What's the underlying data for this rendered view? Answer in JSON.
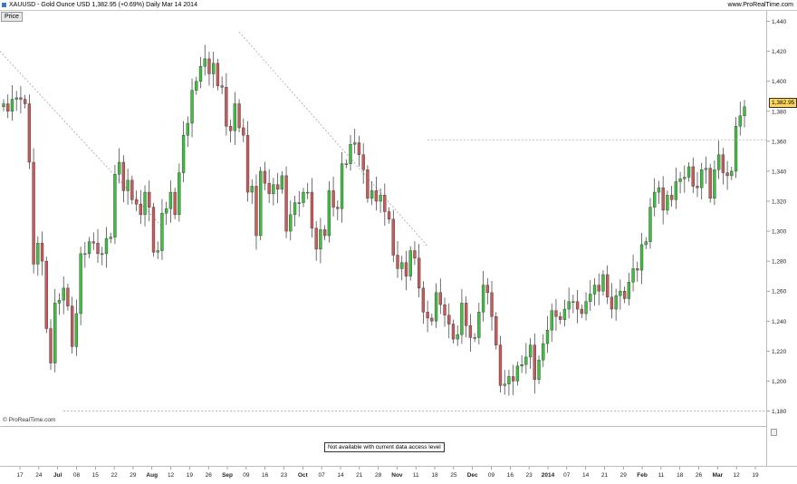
{
  "header": {
    "title": "XAUUSD - Gold Ounce USD     1,382.95 (+0.69%)     Daily  Mar 14 2014",
    "brand": "www.ProRealTime.com"
  },
  "panel_tab": "Price",
  "copyright": "© ProRealTime.com",
  "indicator_notice": "Not available with current data access level",
  "colors": {
    "up": "#3fbf3f",
    "down": "#c85a5a",
    "wick": "#333333",
    "trend": "#999999",
    "last_price_bg": "#ffd65c"
  },
  "chart_data": {
    "type": "candlestick",
    "title": "XAUUSD - Gold Ounce USD",
    "last_price_label": "1,382.95",
    "ylim": [
      1170,
      1447
    ],
    "y_ticks": [
      "1,180",
      "1,200",
      "1,220",
      "1,240",
      "1,260",
      "1,280",
      "1,300",
      "1,320",
      "1,340",
      "1,360",
      "1,380",
      "1,400",
      "1,420",
      "1,440"
    ],
    "x_ticks": [
      "17",
      "24",
      "Jul",
      "08",
      "15",
      "22",
      "29",
      "Aug",
      "12",
      "19",
      "26",
      "Sep",
      "09",
      "16",
      "23",
      "Oct",
      "07",
      "14",
      "21",
      "28",
      "Nov",
      "11",
      "18",
      "25",
      "Dec",
      "09",
      "16",
      "23",
      "2014",
      "07",
      "14",
      "21",
      "29",
      "Feb",
      "11",
      "18",
      "26",
      "Mar",
      "12",
      "19"
    ],
    "bold_x_ticks": [
      "Jul",
      "Aug",
      "Sep",
      "Oct",
      "Nov",
      "Dec",
      "2014",
      "Feb",
      "Mar"
    ],
    "closes": [
      1385,
      1380,
      1388,
      1389,
      1388,
      1385,
      1346,
      1278,
      1292,
      1280,
      1235,
      1212,
      1252,
      1254,
      1262,
      1250,
      1223,
      1245,
      1285,
      1285,
      1293,
      1292,
      1285,
      1285,
      1295,
      1296,
      1338,
      1346,
      1327,
      1334,
      1321,
      1318,
      1311,
      1326,
      1316,
      1286,
      1287,
      1312,
      1315,
      1326,
      1311,
      1339,
      1364,
      1372,
      1394,
      1400,
      1410,
      1415,
      1405,
      1412,
      1397,
      1396,
      1370,
      1367,
      1385,
      1369,
      1364,
      1326,
      1330,
      1297,
      1340,
      1332,
      1325,
      1331,
      1328,
      1337,
      1300,
      1311,
      1319,
      1319,
      1326,
      1326,
      1302,
      1288,
      1301,
      1297,
      1327,
      1316,
      1315,
      1345,
      1345,
      1358,
      1359,
      1351,
      1341,
      1322,
      1327,
      1320,
      1324,
      1313,
      1308,
      1284,
      1275,
      1279,
      1270,
      1287,
      1282,
      1262,
      1246,
      1242,
      1240,
      1259,
      1251,
      1244,
      1238,
      1228,
      1231,
      1252,
      1237,
      1229,
      1229,
      1246,
      1264,
      1259,
      1243,
      1224,
      1197,
      1198,
      1203,
      1200,
      1210,
      1211,
      1216,
      1224,
      1201,
      1214,
      1225,
      1234,
      1247,
      1243,
      1241,
      1248,
      1253,
      1253,
      1248,
      1245,
      1253,
      1258,
      1264,
      1260,
      1271,
      1256,
      1248,
      1257,
      1260,
      1255,
      1266,
      1275,
      1274,
      1291,
      1293,
      1316,
      1326,
      1329,
      1314,
      1324,
      1321,
      1333,
      1335,
      1336,
      1343,
      1330,
      1329,
      1341,
      1342,
      1322,
      1341,
      1351,
      1339,
      1337,
      1340,
      1370,
      1377,
      1383
    ],
    "series": [
      {
        "name": "XAUUSD",
        "values": "closes"
      }
    ],
    "trendlines": [
      {
        "from": [
          "Jun 14",
          1420
        ],
        "to": [
          "Aug 01",
          1303
        ]
      },
      {
        "from": [
          "Aug 27",
          1433
        ],
        "to": [
          "Oct 28",
          1290
        ]
      },
      {
        "from": [
          "Oct 28",
          1361
        ],
        "to": [
          "Mar 14",
          1361
        ]
      },
      {
        "from": [
          "Jun 28",
          1180
        ],
        "to": [
          "Mar 14",
          1180
        ]
      }
    ],
    "grid": false,
    "legend": "none"
  }
}
